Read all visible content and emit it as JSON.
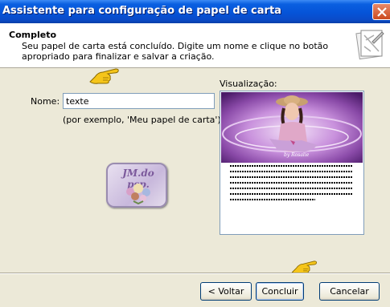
{
  "window": {
    "title": "Assistente para configuração de papel de carta"
  },
  "header": {
    "title": "Completo",
    "description": "Seu papel de carta está concluído. Digite um nome e clique no botão apropriado para finalizar e salvar a criação."
  },
  "form": {
    "name_label": "Nome:",
    "name_value": "texte",
    "example_hint": "(por exemplo, 'Meu papel de carta')"
  },
  "preview": {
    "label": "Visualização:",
    "art_caption": "by Rosalie"
  },
  "logo": {
    "text": "JM.do psp."
  },
  "buttons": {
    "back": "< Voltar",
    "finish": "Concluir",
    "cancel": "Cancelar"
  },
  "colors": {
    "titlebar": "#0554d8",
    "dialog_bg": "#ece9d8",
    "preview_purple": "#8a4aa8"
  }
}
